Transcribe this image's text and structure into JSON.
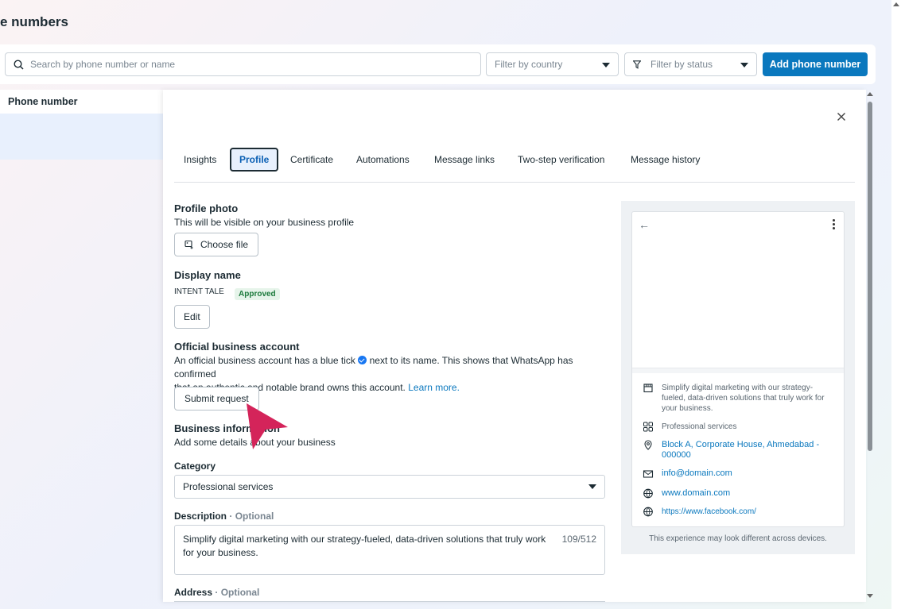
{
  "page": {
    "title": "e numbers"
  },
  "toolbar": {
    "search_placeholder": "Search by phone number or name",
    "filter_country": "Filter by country",
    "filter_status": "Filter by status",
    "add_button": "Add phone number"
  },
  "list": {
    "header": "Phone number"
  },
  "drawer": {
    "tabs": [
      {
        "label": "Insights"
      },
      {
        "label": "Profile"
      },
      {
        "label": "Certificate"
      },
      {
        "label": "Automations"
      },
      {
        "label": "Message links"
      },
      {
        "label": "Two-step verification"
      },
      {
        "label": "Message history"
      }
    ],
    "profile_photo": {
      "title": "Profile photo",
      "subtitle": "This will be visible on your business profile",
      "button": "Choose file"
    },
    "display_name": {
      "title": "Display name",
      "value": "INTENT TALE",
      "status": "Approved",
      "edit_button": "Edit"
    },
    "official_account": {
      "title": "Official business account",
      "text_before": "An official business account has a blue tick",
      "text_after": "next to its name. This shows that WhatsApp has confirmed",
      "text_line2": "that an authentic and notable brand owns this account.",
      "learn_more": "Learn more.",
      "button": "Submit request"
    },
    "business_info": {
      "title": "Business information",
      "subtitle": "Add some details about your business"
    },
    "category": {
      "label": "Category",
      "value": "Professional services"
    },
    "description": {
      "label": "Description",
      "optional": "· Optional",
      "value": "Simplify digital marketing with our strategy-fueled, data-driven solutions that truly work for your business.",
      "count": "109/512"
    },
    "address": {
      "label": "Address",
      "optional": "· Optional"
    }
  },
  "preview": {
    "description": "Simplify digital marketing with our strategy-fueled, data-driven solutions that truly work for your business.",
    "category": "Professional services",
    "address": "Block A, Corporate House, Ahmedabad - 000000",
    "email": "info@domain.com",
    "website": "www.domain.com",
    "facebook": "https://www.facebook.com/",
    "note": "This experience may look different across devices."
  },
  "colors": {
    "accent": "#0a78be",
    "cursor": "#d4245a",
    "approved": "#1c7a3c"
  }
}
